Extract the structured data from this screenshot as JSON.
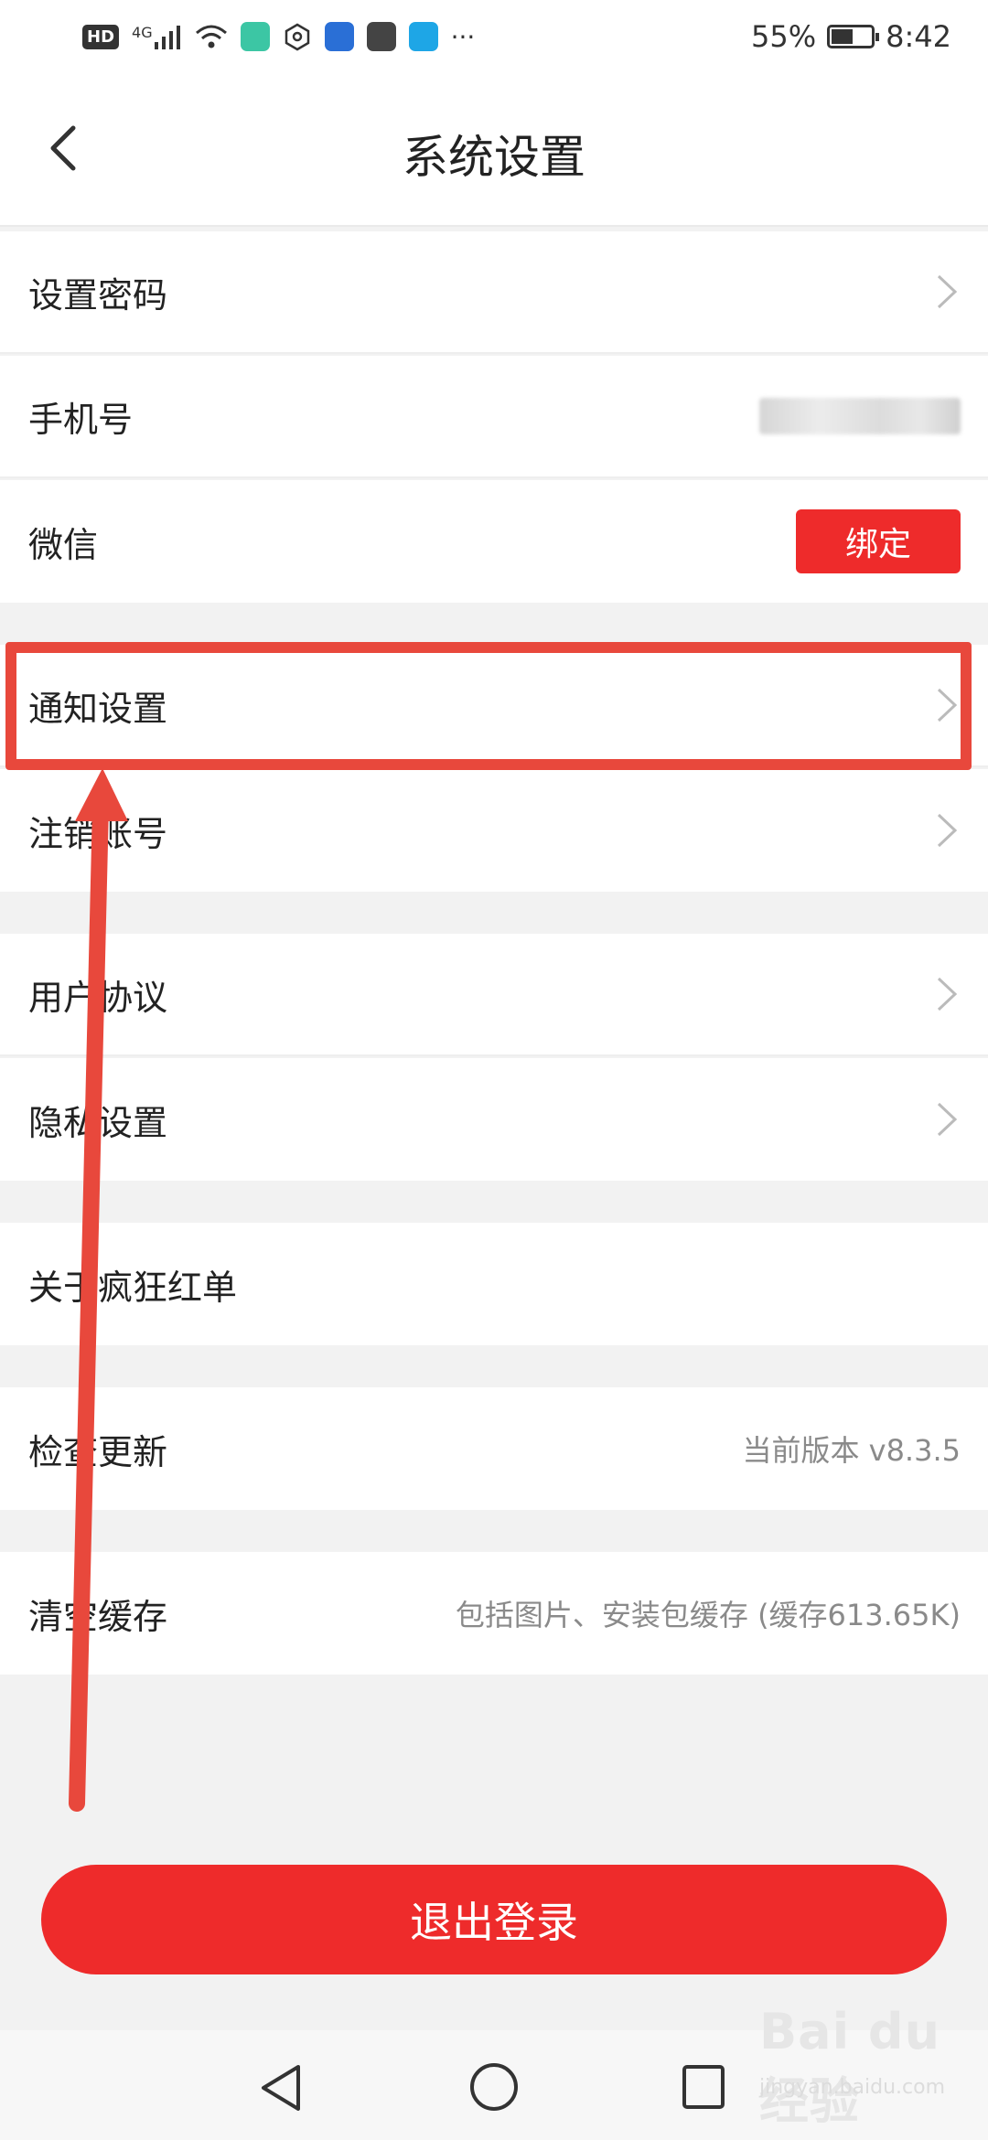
{
  "status_bar": {
    "badges": [
      "HD",
      "4G"
    ],
    "battery_text": "55%",
    "battery_level": 0.55,
    "time": "8:42",
    "more_icons": "···"
  },
  "header": {
    "title": "系统设置"
  },
  "settings": {
    "set_password": "设置密码",
    "phone": "手机号",
    "wechat": "微信",
    "wechat_bind": "绑定",
    "notification": "通知设置",
    "deactivate": "注销账号",
    "user_agreement": "用户协议",
    "privacy": "隐私设置",
    "about": "关于疯狂红单",
    "check_update": "检查更新",
    "current_version": "当前版本 v8.3.5",
    "clear_cache": "清空缓存",
    "cache_hint": "包括图片、安装包缓存 (缓存613.65K)"
  },
  "logout_label": "退出登录",
  "watermark": {
    "main": "Bai du 经验",
    "sub": "jingyan.baidu.com"
  },
  "colors": {
    "accent": "#ee2b2b",
    "annotation": "#e8483c"
  }
}
